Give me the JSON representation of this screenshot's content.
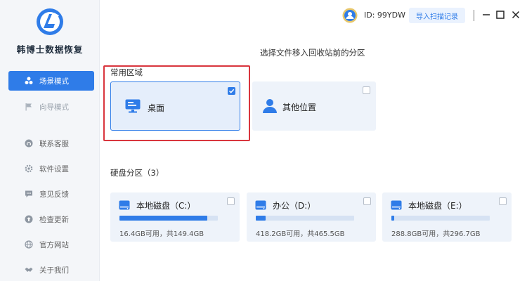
{
  "brand": {
    "name": "韩博士数据恢复"
  },
  "sidebar": {
    "items": [
      {
        "label": "场景模式",
        "icon": "cluster-icon",
        "active": true
      },
      {
        "label": "向导模式",
        "icon": "flag-icon",
        "disabled": true
      },
      {
        "label": "联系客服",
        "icon": "headset-icon"
      },
      {
        "label": "软件设置",
        "icon": "gear-icon"
      },
      {
        "label": "意见反馈",
        "icon": "feedback-icon"
      },
      {
        "label": "检查更新",
        "icon": "update-icon"
      },
      {
        "label": "官方网站",
        "icon": "globe-icon"
      },
      {
        "label": "关于我们",
        "icon": "handshake-icon"
      }
    ]
  },
  "header": {
    "user_id": "ID: 99YDW",
    "import_label": "导入扫描记录"
  },
  "main": {
    "subtitle": "选择文件移入回收站前的分区",
    "common_section": {
      "title": "常用区域",
      "items": [
        {
          "label": "桌面",
          "icon": "monitor-icon",
          "checked": true
        },
        {
          "label": "其他位置",
          "icon": "user-icon",
          "checked": false
        }
      ]
    },
    "disk_section": {
      "title": "硬盘分区（3）",
      "disks": [
        {
          "name": "本地磁盘（C:）",
          "info": "16.4GB可用，共149.4GB",
          "used_fraction": 0.89
        },
        {
          "name": "办公（D:）",
          "info": "418.2GB可用，共465.5GB",
          "used_fraction": 0.1
        },
        {
          "name": "本地磁盘（E:）",
          "info": "288.8GB可用，共296.7GB",
          "used_fraction": 0.03
        }
      ]
    }
  },
  "colors": {
    "accent": "#2f7ce8",
    "highlight": "#d9363e",
    "card_bg": "#eef3fa"
  }
}
